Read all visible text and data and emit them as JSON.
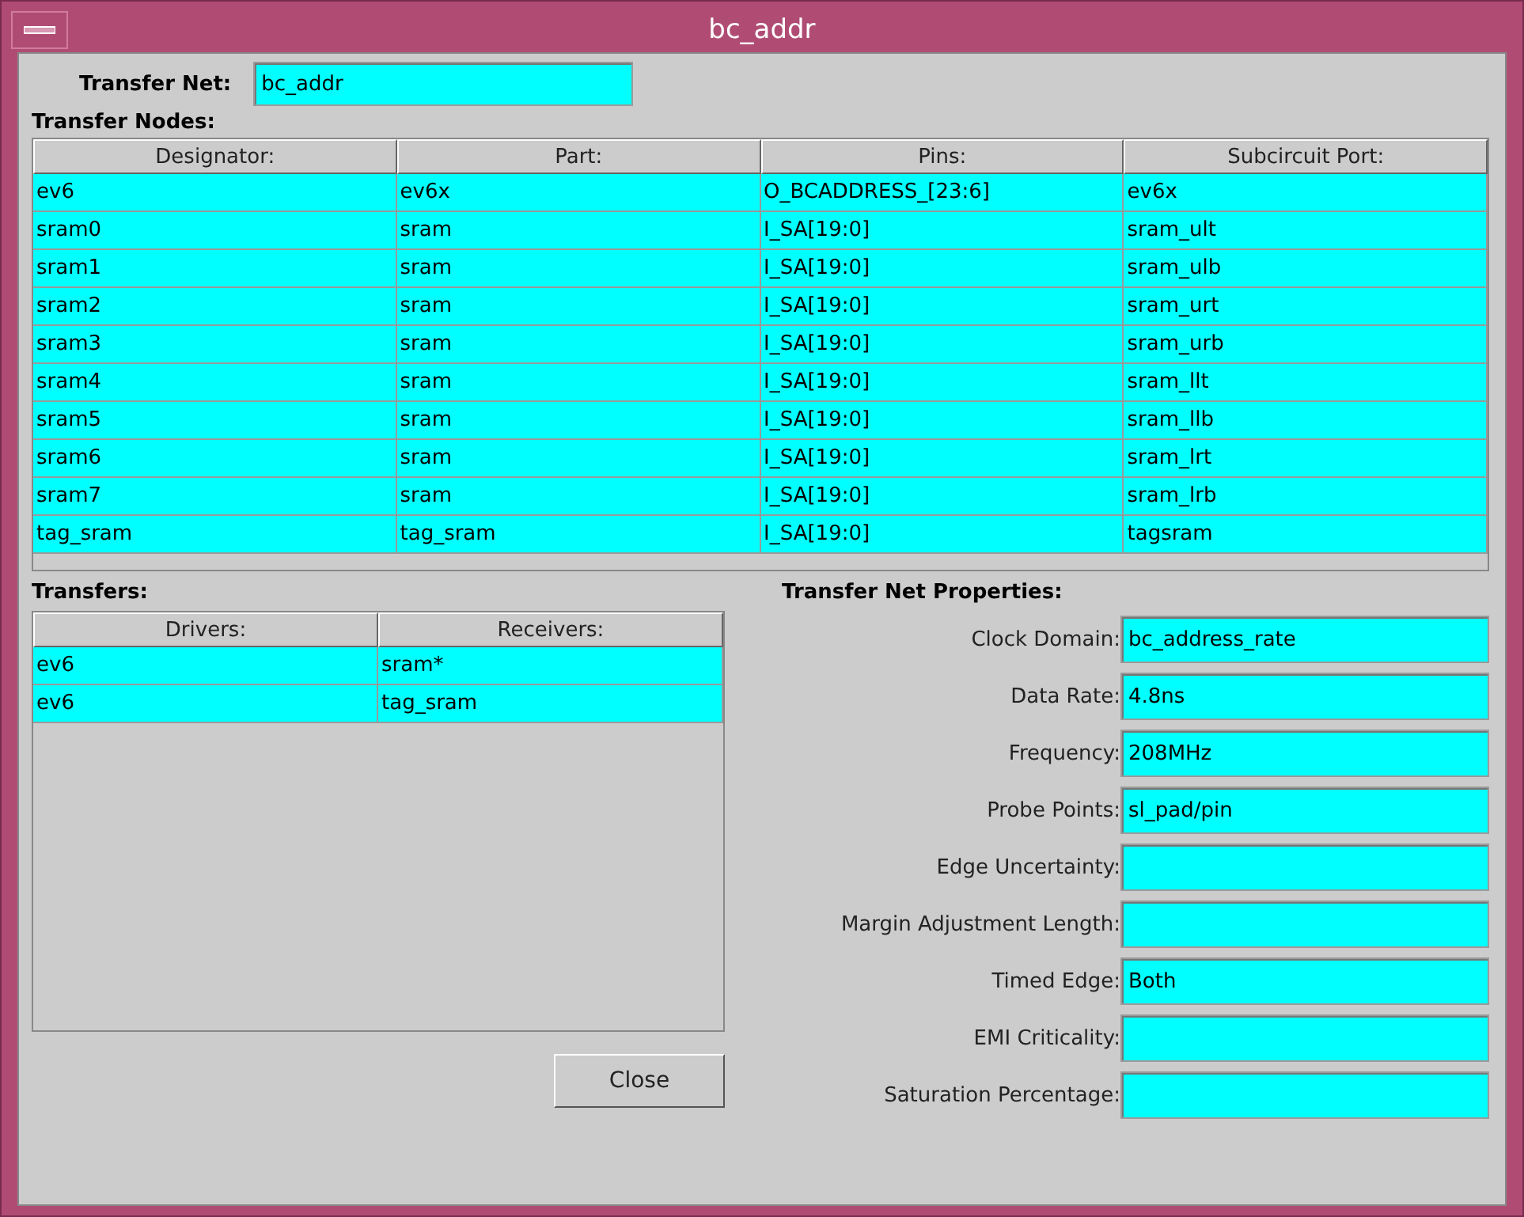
{
  "window": {
    "title": "bc_addr"
  },
  "transfer_net": {
    "label": "Transfer Net:",
    "value": "bc_addr"
  },
  "transfer_nodes": {
    "title": "Transfer Nodes:",
    "columns": [
      "Designator:",
      "Part:",
      "Pins:",
      "Subcircuit Port:"
    ],
    "rows": [
      [
        "ev6",
        "ev6x",
        "O_BCADDRESS_[23:6]",
        "ev6x"
      ],
      [
        "sram0",
        "sram",
        "I_SA[19:0]",
        "sram_ult"
      ],
      [
        "sram1",
        "sram",
        "I_SA[19:0]",
        "sram_ulb"
      ],
      [
        "sram2",
        "sram",
        "I_SA[19:0]",
        "sram_urt"
      ],
      [
        "sram3",
        "sram",
        "I_SA[19:0]",
        "sram_urb"
      ],
      [
        "sram4",
        "sram",
        "I_SA[19:0]",
        "sram_llt"
      ],
      [
        "sram5",
        "sram",
        "I_SA[19:0]",
        "sram_llb"
      ],
      [
        "sram6",
        "sram",
        "I_SA[19:0]",
        "sram_lrt"
      ],
      [
        "sram7",
        "sram",
        "I_SA[19:0]",
        "sram_lrb"
      ],
      [
        "tag_sram",
        "tag_sram",
        "I_SA[19:0]",
        "tagsram"
      ]
    ]
  },
  "transfers": {
    "title": "Transfers:",
    "columns": [
      "Drivers:",
      "Receivers:"
    ],
    "rows": [
      [
        "ev6",
        "sram*"
      ],
      [
        "ev6",
        "tag_sram"
      ]
    ]
  },
  "properties": {
    "title": "Transfer Net Properties:",
    "fields": [
      {
        "label": "Clock Domain:",
        "value": "bc_address_rate"
      },
      {
        "label": "Data Rate:",
        "value": "4.8ns"
      },
      {
        "label": "Frequency:",
        "value": "208MHz"
      },
      {
        "label": "Probe Points:",
        "value": "sl_pad/pin"
      },
      {
        "label": "Edge Uncertainty:"
      },
      {
        "label": "Margin Adjustment Length:"
      },
      {
        "label": "Timed Edge:",
        "value": "Both"
      },
      {
        "label": "EMI Criticality:"
      },
      {
        "label": "Saturation Percentage:"
      }
    ]
  },
  "buttons": [
    {
      "label": "Close"
    }
  ]
}
